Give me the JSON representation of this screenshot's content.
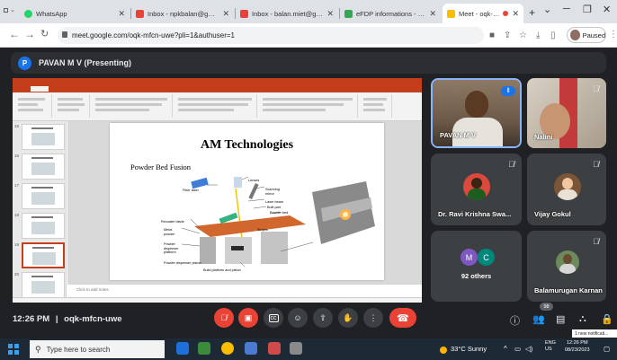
{
  "browser": {
    "tabs": [
      {
        "title": "WhatsApp",
        "color": "#25d366"
      },
      {
        "title": "Inbox - npkbalan@gmai...",
        "color": "#ea4335"
      },
      {
        "title": "Inbox - balan.miet@gma...",
        "color": "#ea4335"
      },
      {
        "title": "eFDP informations - Goo...",
        "color": "#34a853"
      },
      {
        "title": "Meet - oqk-mfcn-uw...",
        "color": "#fbbc04"
      }
    ],
    "new_tab": "+",
    "url": "meet.google.com/oqk-mfcn-uwe?pli=1&authuser=1",
    "profile_label": "Paused"
  },
  "meet": {
    "presenter_initial": "P",
    "presenter_header": "PAVAN M V (Presenting)",
    "slide": {
      "title": "AM Technologies",
      "subtitle": "Powder Bed Fusion",
      "labels": [
        "Lenses",
        "Fiber laser",
        "Scanning mirror",
        "Laser beam",
        "Built part",
        "Powder bed",
        "Stripes",
        "Recoater blade",
        "Metal powder",
        "Powder dispenser platform",
        "Powder dispenser piston",
        "Build platform and piston"
      ],
      "notes_placeholder": "Click to add notes"
    },
    "thumb_numbers": [
      "15",
      "16",
      "17",
      "18",
      "19",
      "20"
    ],
    "participants": [
      {
        "name": "PAVAN M V"
      },
      {
        "name": "Nalini"
      },
      {
        "name": "Dr. Ravi Krishna Swa..."
      },
      {
        "name": "Vijay Gokul"
      },
      {
        "name": "92 others",
        "initials": [
          "M",
          "C"
        ]
      },
      {
        "name": "Balamurugan Karnan"
      }
    ],
    "time": "12:26 PM",
    "separator": "|",
    "meeting_code": "oqk-mfcn-uwe",
    "participant_count": "98",
    "notification": "1 new notificati..."
  },
  "taskbar": {
    "search_placeholder": "Type here to search",
    "weather": "33°C  Sunny",
    "lang_top": "ENG",
    "lang_bottom": "US",
    "clock_time": "12:26 PM",
    "clock_date": "08/23/2023"
  },
  "colors": {
    "meet_bg": "#202124",
    "tile_bg": "#3c4043",
    "accent_blue": "#1a73e8",
    "danger_red": "#ea4335",
    "ppt_orange": "#c43e1c"
  }
}
